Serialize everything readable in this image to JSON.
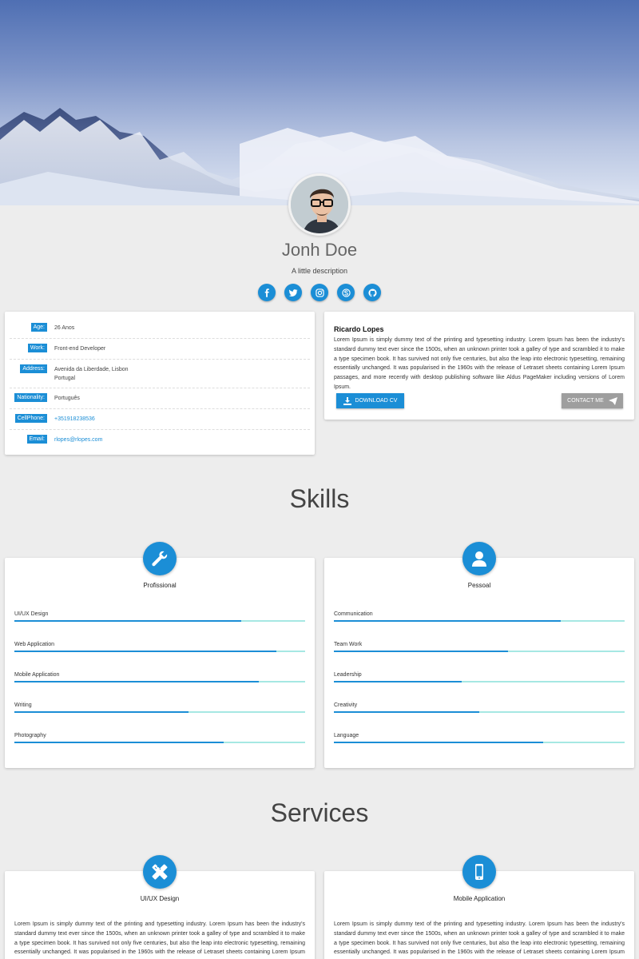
{
  "profile": {
    "name": "Jonh Doe",
    "description": "A little description"
  },
  "socials": [
    {
      "icon": "facebook-icon"
    },
    {
      "icon": "twitter-icon"
    },
    {
      "icon": "instagram-icon"
    },
    {
      "icon": "skype-icon"
    },
    {
      "icon": "github-icon"
    }
  ],
  "info": [
    {
      "label": "Age:",
      "value": "26 Anos"
    },
    {
      "label": "Work:",
      "value": "Front-end Developer"
    },
    {
      "label": "Address:",
      "value": "Avenida da Liberdade, Lisbon",
      "value2": "Portugal"
    },
    {
      "label": "Nationality:",
      "value": "Português"
    },
    {
      "label": "CellPhone:",
      "value": "+351918238536"
    },
    {
      "label": "Email:",
      "value": "rlopes@rlopes.com"
    }
  ],
  "about": {
    "name": "Ricardo Lopes",
    "text": "Lorem Ipsum is simply dummy text of the printing and typesetting industry. Lorem Ipsum has been the industry's standard dummy text ever since the 1500s, when an unknown printer took a galley of type and scrambled it to make a type specimen book. It has survived not only five centuries, but also the leap into electronic typesetting, remaining essentially unchanged. It was popularised in the 1960s with the release of Letraset sheets containing Lorem Ipsum passages, and more recently with desktop publishing software like Aldus PageMaker including versions of Lorem Ipsum.",
    "download_label": "DOWNLOAD CV",
    "contact_label": "CONTACT ME"
  },
  "skills": {
    "title": "Skills",
    "professional": {
      "heading": "Profissional",
      "icon": "wrench-icon",
      "items": [
        {
          "label": "UI/UX Design",
          "level": 0.78
        },
        {
          "label": "Web Application",
          "level": 0.9
        },
        {
          "label": "Mobile Application",
          "level": 0.84
        },
        {
          "label": "Writing",
          "level": 0.6
        },
        {
          "label": "Photography",
          "level": 0.72
        }
      ]
    },
    "personal": {
      "heading": "Pessoal",
      "icon": "user-icon",
      "items": [
        {
          "label": "Communication",
          "level": 0.78
        },
        {
          "label": "Team Work",
          "level": 0.6
        },
        {
          "label": "Leadership",
          "level": 0.44
        },
        {
          "label": "Creativity",
          "level": 0.5
        },
        {
          "label": "Language",
          "level": 0.72
        }
      ]
    }
  },
  "services": {
    "title": "Services",
    "items": [
      {
        "heading": "UI/UX Design",
        "icon": "pencil-ruler-icon",
        "text": "Lorem Ipsum is simply dummy text of the printing and typesetting industry. Lorem Ipsum has been the industry's standard dummy text ever since the 1500s, when an unknown printer took a galley of type and scrambled it to make a type specimen book. It has survived not only five centuries, but also the leap into electronic typesetting, remaining essentially unchanged. It was popularised in the 1960s with the release of Letraset sheets containing Lorem Ipsum passages."
      },
      {
        "heading": "Mobile Application",
        "icon": "mobile-icon",
        "text": "Lorem Ipsum is simply dummy text of the printing and typesetting industry. Lorem Ipsum has been the industry's standard dummy text ever since the 1500s, when an unknown printer took a galley of type and scrambled it to make a type specimen book. It has survived not only five centuries, but also the leap into electronic typesetting, remaining essentially unchanged. It was popularised in the 1960s with the release of Letraset sheets containing Lorem Ipsum passages."
      }
    ]
  },
  "colors": {
    "accent": "#1b8ed6",
    "track": "#a6e8e3",
    "background": "#ededed"
  }
}
